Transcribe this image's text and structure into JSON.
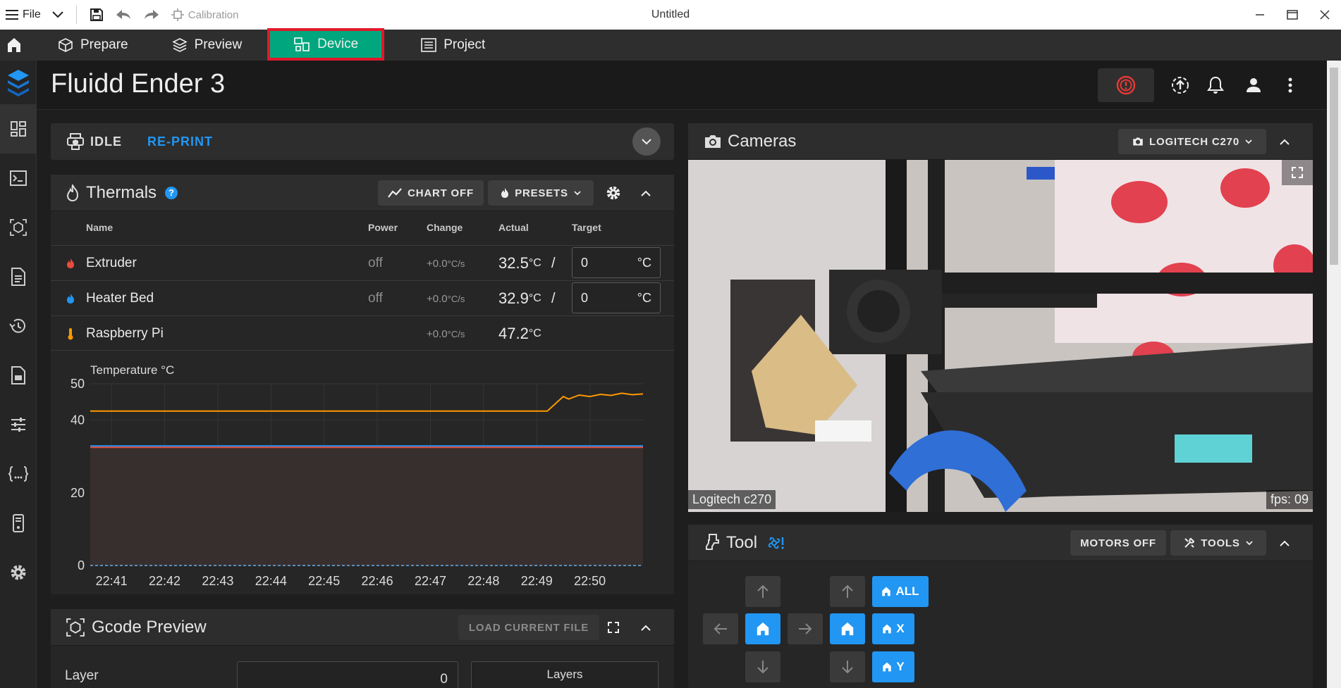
{
  "titlebar": {
    "file_label": "File",
    "calibration_label": "Calibration",
    "window_title": "Untitled"
  },
  "tabs": [
    {
      "label": "Prepare",
      "icon": "cube-icon"
    },
    {
      "label": "Preview",
      "icon": "layers-icon"
    },
    {
      "label": "Device",
      "icon": "device-icon",
      "active": true
    },
    {
      "label": "Project",
      "icon": "list-icon"
    }
  ],
  "header": {
    "printer_name": "Fluidd Ender 3"
  },
  "status": {
    "state": "IDLE",
    "reprint_label": "RE-PRINT"
  },
  "thermals": {
    "title": "Thermals",
    "chart_button": "CHART OFF",
    "presets_button": "PRESETS",
    "columns": {
      "name": "Name",
      "power": "Power",
      "change": "Change",
      "actual": "Actual",
      "target": "Target"
    },
    "rows": [
      {
        "name": "Extruder",
        "power": "off",
        "change": "+0.0",
        "change_unit": "°C/s",
        "actual": "32.5",
        "actual_unit": "°C",
        "separator": "/",
        "target": "0",
        "target_unit": "°C",
        "icon_color": "#e74c3c"
      },
      {
        "name": "Heater Bed",
        "power": "off",
        "change": "+0.0",
        "change_unit": "°C/s",
        "actual": "32.9",
        "actual_unit": "°C",
        "separator": "/",
        "target": "0",
        "target_unit": "°C",
        "icon_color": "#2196f3"
      },
      {
        "name": "Raspberry Pi",
        "power": "",
        "change": "+0.0",
        "change_unit": "°C/s",
        "actual": "47.2",
        "actual_unit": "°C",
        "icon_color": "#ff9800"
      }
    ]
  },
  "chart_data": {
    "type": "line",
    "title": "Temperature °C",
    "x": [
      "22:41",
      "22:42",
      "22:43",
      "22:44",
      "22:45",
      "22:46",
      "22:47",
      "22:48",
      "22:49",
      "22:50"
    ],
    "yticks": [
      0,
      20,
      40,
      50
    ],
    "ylim": [
      0,
      50
    ],
    "series": [
      {
        "key": "raspberry_pi",
        "color": "#ff9800",
        "points": [
          [
            0,
            42.5
          ],
          [
            8.6,
            42.5
          ],
          [
            8.75,
            44.5
          ],
          [
            8.9,
            46.5
          ],
          [
            9.0,
            45.8
          ],
          [
            9.2,
            46.9
          ],
          [
            9.4,
            46.5
          ],
          [
            9.6,
            47.1
          ],
          [
            9.8,
            46.8
          ],
          [
            10.0,
            47.4
          ],
          [
            10.2,
            47.0
          ],
          [
            10.4,
            47.2
          ]
        ]
      },
      {
        "key": "heater_bed",
        "color": "#2196f3",
        "points": [
          [
            0,
            32.9
          ],
          [
            10.4,
            32.9
          ]
        ]
      },
      {
        "key": "extruder",
        "color": "#e74c3c",
        "points": [
          [
            0,
            32.5
          ],
          [
            10.4,
            32.5
          ]
        ]
      },
      {
        "key": "targets",
        "color": "#5b8dbb",
        "points": [
          [
            0,
            0
          ],
          [
            10.4,
            0
          ]
        ],
        "dashed": true
      }
    ],
    "grid": true
  },
  "gcode_preview": {
    "title": "Gcode Preview",
    "load_button": "LOAD CURRENT FILE",
    "layer_label": "Layer",
    "layer_value": "0",
    "layers_label": "Layers"
  },
  "cameras": {
    "title": "Cameras",
    "selector": "LOGITECH C270",
    "camera_name": "Logitech c270",
    "fps": "fps: 09"
  },
  "tool": {
    "title": "Tool",
    "motors_off": "MOTORS OFF",
    "tools_button": "TOOLS",
    "home_all": "ALL",
    "home_x": "X",
    "home_y": "Y"
  }
}
